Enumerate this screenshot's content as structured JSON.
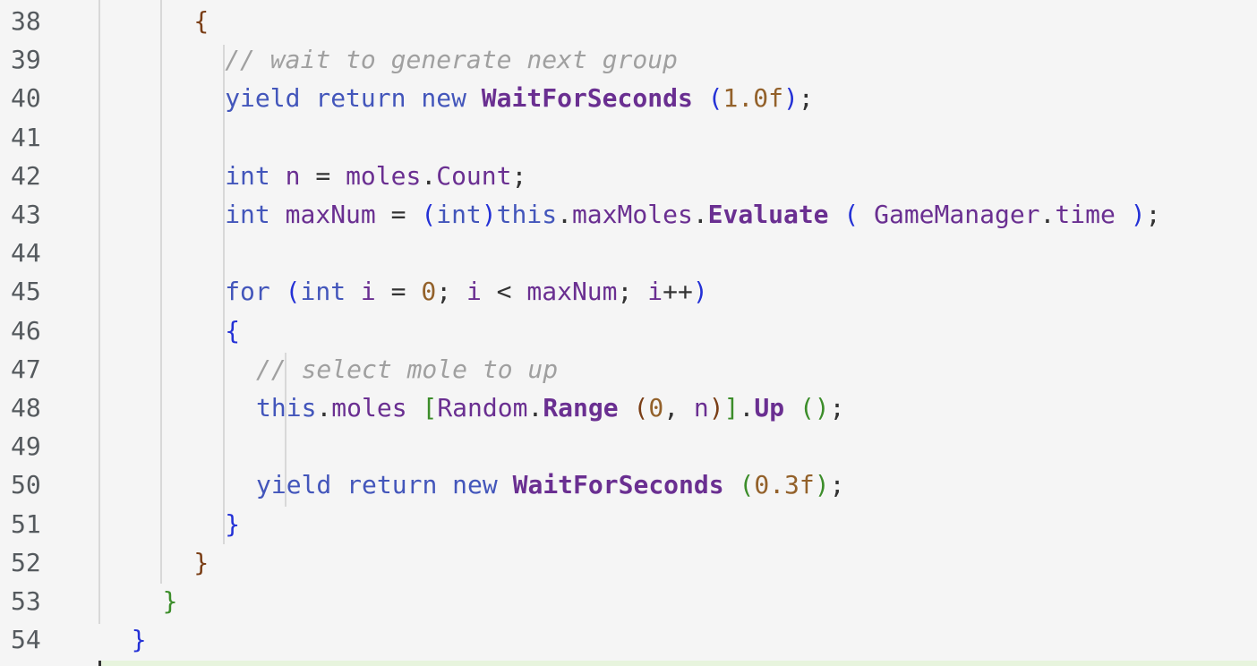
{
  "editor": {
    "lines": [
      {
        "number": "38",
        "indent": 6,
        "tokens": [
          {
            "t": "{",
            "c": "p-brown"
          }
        ]
      },
      {
        "number": "39",
        "indent": 8,
        "tokens": [
          {
            "t": "// wait to generate next group",
            "c": "cm"
          }
        ]
      },
      {
        "number": "40",
        "indent": 8,
        "tokens": [
          {
            "t": "yield",
            "c": "kw"
          },
          {
            "t": " "
          },
          {
            "t": "return",
            "c": "kw"
          },
          {
            "t": " "
          },
          {
            "t": "new",
            "c": "kw"
          },
          {
            "t": " "
          },
          {
            "t": "WaitForSeconds",
            "c": "fn"
          },
          {
            "t": " "
          },
          {
            "t": "(",
            "c": "p-blue"
          },
          {
            "t": "1.0f",
            "c": "num"
          },
          {
            "t": ")",
            "c": "p-blue"
          },
          {
            "t": ";",
            "c": "op"
          }
        ]
      },
      {
        "number": "41",
        "indent": 0,
        "tokens": []
      },
      {
        "number": "42",
        "indent": 8,
        "tokens": [
          {
            "t": "int",
            "c": "ty"
          },
          {
            "t": " "
          },
          {
            "t": "n",
            "c": "id"
          },
          {
            "t": " = ",
            "c": "op"
          },
          {
            "t": "moles",
            "c": "id"
          },
          {
            "t": ".",
            "c": "op"
          },
          {
            "t": "Count",
            "c": "id"
          },
          {
            "t": ";",
            "c": "op"
          }
        ]
      },
      {
        "number": "43",
        "indent": 8,
        "tokens": [
          {
            "t": "int",
            "c": "ty"
          },
          {
            "t": " "
          },
          {
            "t": "maxNum",
            "c": "id"
          },
          {
            "t": " = ",
            "c": "op"
          },
          {
            "t": "(",
            "c": "p-blue"
          },
          {
            "t": "int",
            "c": "ty"
          },
          {
            "t": ")",
            "c": "p-blue"
          },
          {
            "t": "this",
            "c": "kw"
          },
          {
            "t": ".",
            "c": "op"
          },
          {
            "t": "maxMoles",
            "c": "id"
          },
          {
            "t": ".",
            "c": "op"
          },
          {
            "t": "Evaluate",
            "c": "fn"
          },
          {
            "t": " "
          },
          {
            "t": "(",
            "c": "p-blue"
          },
          {
            "t": " "
          },
          {
            "t": "GameManager",
            "c": "id"
          },
          {
            "t": ".",
            "c": "op"
          },
          {
            "t": "time",
            "c": "id"
          },
          {
            "t": " "
          },
          {
            "t": ")",
            "c": "p-blue"
          },
          {
            "t": ";",
            "c": "op"
          }
        ]
      },
      {
        "number": "44",
        "indent": 0,
        "tokens": []
      },
      {
        "number": "45",
        "indent": 8,
        "tokens": [
          {
            "t": "for",
            "c": "kw"
          },
          {
            "t": " "
          },
          {
            "t": "(",
            "c": "p-blue"
          },
          {
            "t": "int",
            "c": "ty"
          },
          {
            "t": " "
          },
          {
            "t": "i",
            "c": "id"
          },
          {
            "t": " = ",
            "c": "op"
          },
          {
            "t": "0",
            "c": "num"
          },
          {
            "t": "; ",
            "c": "op"
          },
          {
            "t": "i",
            "c": "id"
          },
          {
            "t": " < ",
            "c": "op"
          },
          {
            "t": "maxNum",
            "c": "id"
          },
          {
            "t": "; ",
            "c": "op"
          },
          {
            "t": "i",
            "c": "id"
          },
          {
            "t": "++",
            "c": "op"
          },
          {
            "t": ")",
            "c": "p-blue"
          }
        ]
      },
      {
        "number": "46",
        "indent": 8,
        "tokens": [
          {
            "t": "{",
            "c": "p-blue"
          }
        ]
      },
      {
        "number": "47",
        "indent": 10,
        "tokens": [
          {
            "t": "// select mole to up",
            "c": "cm"
          }
        ]
      },
      {
        "number": "48",
        "indent": 10,
        "tokens": [
          {
            "t": "this",
            "c": "kw"
          },
          {
            "t": ".",
            "c": "op"
          },
          {
            "t": "moles",
            "c": "id"
          },
          {
            "t": " "
          },
          {
            "t": "[",
            "c": "p-green"
          },
          {
            "t": "Random",
            "c": "id"
          },
          {
            "t": ".",
            "c": "op"
          },
          {
            "t": "Range",
            "c": "fn"
          },
          {
            "t": " "
          },
          {
            "t": "(",
            "c": "p-brown"
          },
          {
            "t": "0",
            "c": "num"
          },
          {
            "t": ", ",
            "c": "op"
          },
          {
            "t": "n",
            "c": "id"
          },
          {
            "t": ")",
            "c": "p-brown"
          },
          {
            "t": "]",
            "c": "p-green"
          },
          {
            "t": ".",
            "c": "op"
          },
          {
            "t": "Up",
            "c": "fn"
          },
          {
            "t": " "
          },
          {
            "t": "()",
            "c": "p-green"
          },
          {
            "t": ";",
            "c": "op"
          }
        ]
      },
      {
        "number": "49",
        "indent": 0,
        "tokens": []
      },
      {
        "number": "50",
        "indent": 10,
        "tokens": [
          {
            "t": "yield",
            "c": "kw"
          },
          {
            "t": " "
          },
          {
            "t": "return",
            "c": "kw"
          },
          {
            "t": " "
          },
          {
            "t": "new",
            "c": "kw"
          },
          {
            "t": " "
          },
          {
            "t": "WaitForSeconds",
            "c": "fn"
          },
          {
            "t": " "
          },
          {
            "t": "(",
            "c": "p-green"
          },
          {
            "t": "0.3f",
            "c": "num"
          },
          {
            "t": ")",
            "c": "p-green"
          },
          {
            "t": ";",
            "c": "op"
          }
        ]
      },
      {
        "number": "51",
        "indent": 8,
        "tokens": [
          {
            "t": "}",
            "c": "p-blue"
          }
        ]
      },
      {
        "number": "52",
        "indent": 6,
        "tokens": [
          {
            "t": "}",
            "c": "p-brown"
          }
        ]
      },
      {
        "number": "53",
        "indent": 4,
        "tokens": [
          {
            "t": "}",
            "c": "p-green"
          }
        ]
      },
      {
        "number": "54",
        "indent": 2,
        "tokens": [
          {
            "t": "}",
            "c": "p-blue"
          }
        ]
      }
    ]
  }
}
